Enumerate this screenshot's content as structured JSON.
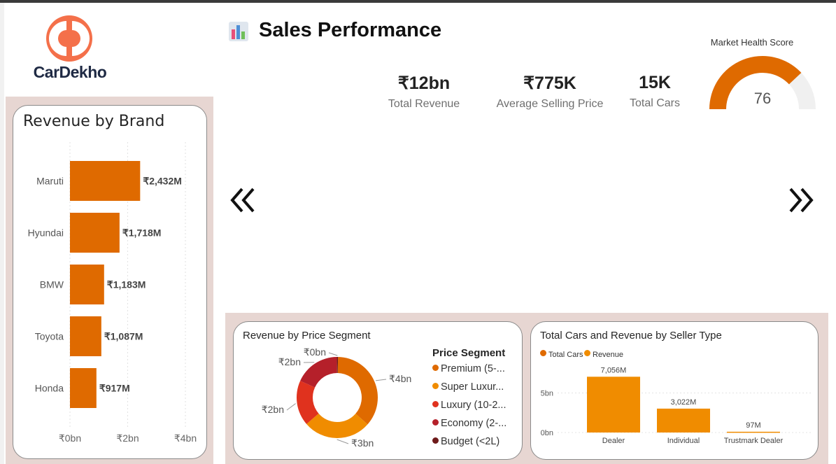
{
  "app": {
    "logo_text": "CarDekho",
    "title": "Sales Performance",
    "title_icon": "bar-chart-icon",
    "colors": {
      "accent": "#df6a00",
      "panel": "#e7d6d2"
    }
  },
  "kpis": [
    {
      "value": "₹12bn",
      "label": "Total Revenue"
    },
    {
      "value": "₹775K",
      "label": "Average Selling Price"
    },
    {
      "value": "15K",
      "label": "Total Cars"
    }
  ],
  "gauge": {
    "title": "Market Health Score",
    "value": "76",
    "fraction": 0.76,
    "fill_color": "#df6a00",
    "track_color": "#f0f0f0"
  },
  "nav": {
    "prev_icon": "double-chevron-left-icon",
    "next_icon": "double-chevron-right-icon"
  },
  "revenue_by_brand": {
    "title": "Revenue by Brand",
    "chart_data": {
      "type": "bar",
      "orientation": "horizontal",
      "categories": [
        "Maruti",
        "Hyundai",
        "BMW",
        "Toyota",
        "Honda"
      ],
      "values": [
        2432,
        1718,
        1183,
        1087,
        917
      ],
      "unit": "₹M",
      "data_labels": [
        "₹2,432M",
        "₹1,718M",
        "₹1,183M",
        "₹1,087M",
        "₹917M"
      ],
      "x_ticks": [
        "₹0bn",
        "₹2bn",
        "₹4bn"
      ],
      "xlim": [
        0,
        4000
      ],
      "color": "#df6a00"
    }
  },
  "revenue_by_segment": {
    "title": "Revenue by Price Segment",
    "legend_title": "Price Segment",
    "chart_data": {
      "type": "pie",
      "style": "donut",
      "labels": [
        "Premium (5-...",
        "Super Luxur...",
        "Luxury (10-2...",
        "Economy (2-...",
        "Budget (<2L)"
      ],
      "values": [
        4,
        3,
        2,
        2,
        0.05
      ],
      "data_labels": [
        "₹4bn",
        "₹3bn",
        "₹2bn",
        "₹2bn",
        "₹0bn"
      ],
      "colors": [
        "#df6a00",
        "#f08c00",
        "#e0321e",
        "#b5202a",
        "#6e1a1a"
      ]
    }
  },
  "seller_type": {
    "title": "Total Cars and Revenue by Seller Type",
    "legend": [
      {
        "label": "Total Cars",
        "color": "#df6a00"
      },
      {
        "label": "Revenue",
        "color": "#f08c00"
      }
    ],
    "chart_data": {
      "type": "bar",
      "categories": [
        "Dealer",
        "Individual",
        "Trustmark Dealer"
      ],
      "series": [
        {
          "name": "Revenue",
          "values": [
            7056,
            3022,
            97
          ],
          "unit": "M"
        }
      ],
      "data_labels": [
        "7,056M",
        "3,022M",
        "97M"
      ],
      "y_ticks": [
        "0bn",
        "5bn"
      ],
      "ylim": [
        0,
        8500
      ],
      "color": "#f08c00"
    }
  }
}
